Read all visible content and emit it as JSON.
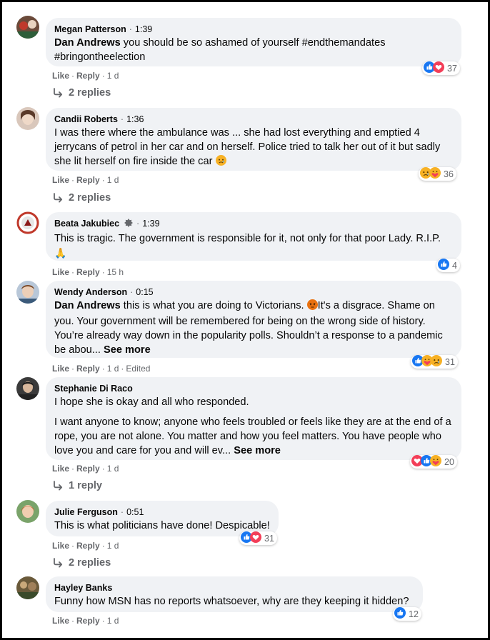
{
  "colors": {
    "bubble": "#f0f2f5",
    "like_blue": "#1877f2",
    "love_red": "#f33e58",
    "haha_yellow": "#f7b125",
    "angry_orange": "#e9710f",
    "meta_text": "#65676b"
  },
  "comments": [
    {
      "author": "Megan Patterson",
      "time": "1:39",
      "mention": "Dan Andrews",
      "text": "you should be so ashamed of yourself #endthemandates #bringontheelection",
      "reactions": [
        "like-icon",
        "love-icon"
      ],
      "reaction_count": "37",
      "actions": {
        "like": "Like",
        "reply": "Reply",
        "age": "1 d"
      },
      "replies": "2 replies"
    },
    {
      "author": "Candii Roberts",
      "time": "1:36",
      "text": "I was there where the ambulance was ... she had lost everything and emptied 4 jerrycans of petrol in her car and on herself. Police tried to talk her out of it but sadly she lit herself on fire inside the car",
      "reactions": [
        "sad-icon",
        "care-icon"
      ],
      "reaction_count": "36",
      "actions": {
        "like": "Like",
        "reply": "Reply",
        "age": "1 d"
      },
      "replies": "2 replies"
    },
    {
      "author": "Beata Jakubiec",
      "time": "1:39",
      "text": "This is tragic. The government is responsible for it, not only for that poor Lady. R.I.P.",
      "reactions": [
        "like-icon"
      ],
      "reaction_count": "4",
      "actions": {
        "like": "Like",
        "reply": "Reply",
        "age": "15 h"
      }
    },
    {
      "author": "Wendy Anderson",
      "time": "0:15",
      "mention": "Dan Andrews",
      "text1": "this is what you are doing to Victorians.",
      "text2": "It's a disgrace. Shame on you. Your government will be remembered for being on the wrong side of history. You’re already way down in the popularity polls. Shouldn’t a response to a pandemic be abou...",
      "see_more": "See more",
      "reactions": [
        "like-icon",
        "care-icon",
        "sad-icon"
      ],
      "reaction_count": "31",
      "actions": {
        "like": "Like",
        "reply": "Reply",
        "age": "1 d",
        "edited": "Edited"
      }
    },
    {
      "author": "Stephanie Di Raco",
      "text_p1": "I hope she is okay and all who responded.",
      "text_p2": "I want anyone to know; anyone who feels troubled or feels like they are at the end of a rope, you are not alone. You matter and how you feel matters. You have people who love you and care for you and will ev...",
      "see_more": "See more",
      "reactions": [
        "love-icon",
        "like-icon",
        "care-icon"
      ],
      "reaction_count": "20",
      "actions": {
        "like": "Like",
        "reply": "Reply",
        "age": "1 d"
      },
      "replies": "1 reply"
    },
    {
      "author": "Julie Ferguson",
      "time": "0:51",
      "text": "This is what politicians have done! Despicable!",
      "reactions": [
        "like-icon",
        "love-icon"
      ],
      "reaction_count": "31",
      "actions": {
        "like": "Like",
        "reply": "Reply",
        "age": "1 d"
      },
      "replies": "2 replies"
    },
    {
      "author": "Hayley Banks",
      "text": "Funny how MSN has no reports whatsoever, why are they keeping it hidden?",
      "reactions": [
        "like-icon"
      ],
      "reaction_count": "12",
      "actions": {
        "like": "Like",
        "reply": "Reply",
        "age": "1 d"
      }
    }
  ]
}
